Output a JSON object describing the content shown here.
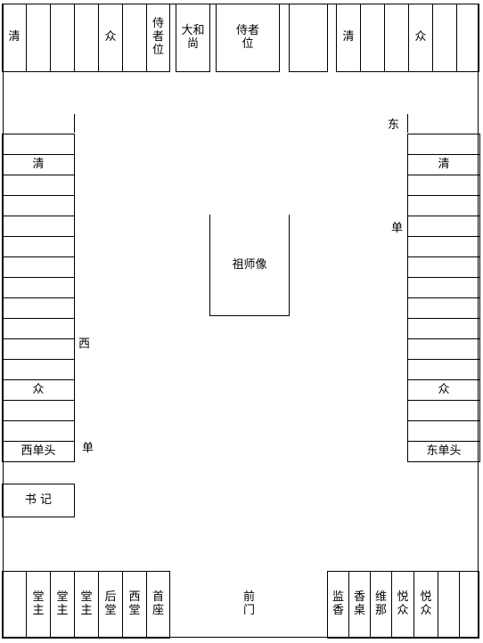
{
  "top_row": [
    "清",
    "",
    "",
    "",
    "众",
    "",
    "侍者\n位",
    "大和尚",
    "侍者\n位",
    "",
    "清",
    "",
    "",
    "众",
    ""
  ],
  "west_column": [
    "",
    "清",
    "",
    "",
    "",
    "",
    "",
    "",
    "",
    "",
    "",
    "",
    "众",
    "",
    "",
    "西单头"
  ],
  "east_column": [
    "",
    "清",
    "",
    "",
    "",
    "",
    "",
    "",
    "",
    "",
    "",
    "",
    "众",
    "",
    "",
    "东单头"
  ],
  "labels": {
    "west_upper": "西",
    "west_lower": "单",
    "east_upper": "东",
    "east_lower": "单"
  },
  "center": "祖师像",
  "secretary": "书 记",
  "bottom_left": [
    "",
    "堂\n主",
    "堂\n主",
    "堂\n主",
    "后\n堂",
    "西\n堂",
    "首\n座"
  ],
  "front_gate": "前\n门",
  "bottom_right": [
    "监\n香",
    "香\n桌",
    "维\n那",
    "悦\n众",
    "悦\n众",
    "",
    ""
  ]
}
